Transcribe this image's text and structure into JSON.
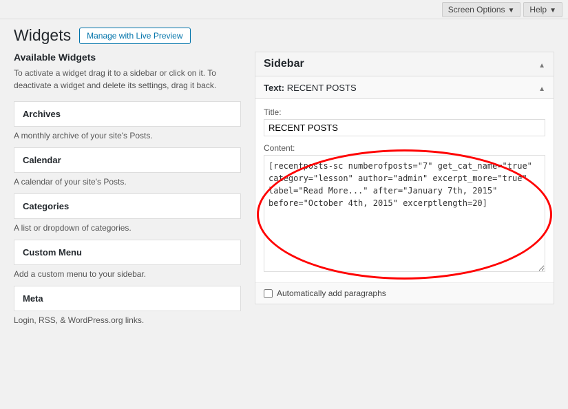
{
  "topbar": {
    "screen_options_label": "Screen Options",
    "help_label": "Help"
  },
  "header": {
    "title": "Widgets",
    "live_preview_label": "Manage with Live Preview"
  },
  "left_panel": {
    "title": "Available Widgets",
    "description": "To activate a widget drag it to a sidebar or click on it. To deactivate a widget and delete its settings, drag it back.",
    "widgets": [
      {
        "title": "Archives",
        "description": "A monthly archive of your site's Posts."
      },
      {
        "title": "Calendar",
        "description": "A calendar of your site's Posts."
      },
      {
        "title": "Categories",
        "description": "A list or dropdown of categories."
      },
      {
        "title": "Custom Menu",
        "description": "Add a custom menu to your sidebar."
      },
      {
        "title": "Meta",
        "description": "Login, RSS, & WordPress.org links."
      }
    ]
  },
  "right_panel": {
    "sidebar_title": "Sidebar",
    "text_widget": {
      "header_label": "Text:",
      "header_name": "RECENT POSTS",
      "title_label": "Title:",
      "title_value": "RECENT POSTS",
      "content_label": "Content:",
      "content_value": "[recentposts-sc numberofposts=\"7\" get_cat_name=\"true\"\ncategory=\"lesson\" author=\"admin\" excerpt_more=\"true\"\nlabel=\"Read More...\" after=\"January 7th, 2015\"\nbefore=\"October 4th, 2015\" excerptlength=20]"
    },
    "auto_paragraphs_label": "Automatically add paragraphs"
  }
}
